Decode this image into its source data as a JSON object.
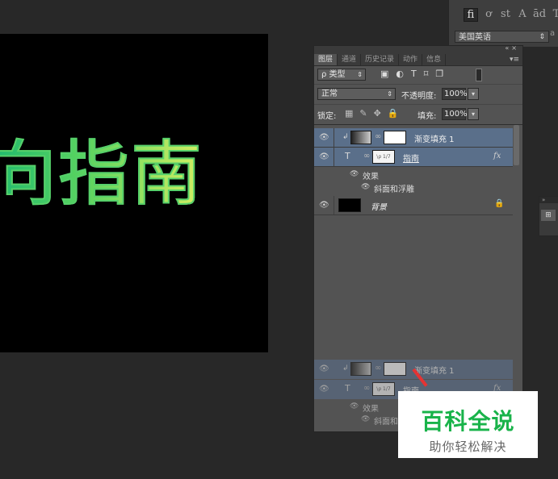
{
  "canvas": {
    "text": "向指南"
  },
  "character_panel": {
    "glyph_buttons": [
      "fi",
      "ơ",
      "st",
      "A",
      "ād",
      "T"
    ],
    "language": "美国英语",
    "side_text": "a"
  },
  "layers_panel": {
    "tabs": [
      "图层",
      "通道",
      "历史记录",
      "动作",
      "信息"
    ],
    "filter": {
      "kind": "ρ 类型"
    },
    "blend_mode": "正常",
    "opacity": {
      "label": "不透明度:",
      "value": "100%"
    },
    "lock": {
      "label": "锁定:"
    },
    "fill": {
      "label": "填充:",
      "value": "100%"
    },
    "layers": [
      {
        "name": "渐变填充 1",
        "selected": true
      },
      {
        "name": "指南",
        "thumb_text": "\\ρ 1/7",
        "fx": "fx",
        "selected": true,
        "effects_label": "效果",
        "effect": "斜面和浮雕"
      },
      {
        "name": "背景"
      }
    ],
    "ghost_layers": [
      {
        "name": "渐变填充 1"
      },
      {
        "name": "指南",
        "thumb_text": "\\ρ 1/7",
        "fx": "fx",
        "effects_label": "效果",
        "effect": "斜面和"
      }
    ]
  },
  "watermark": {
    "title": "百科全说",
    "subtitle": "助你轻松解决"
  },
  "colors": {
    "panel": "#535353",
    "selected": "#5a6f8a",
    "watermark_green": "#19b34a"
  }
}
